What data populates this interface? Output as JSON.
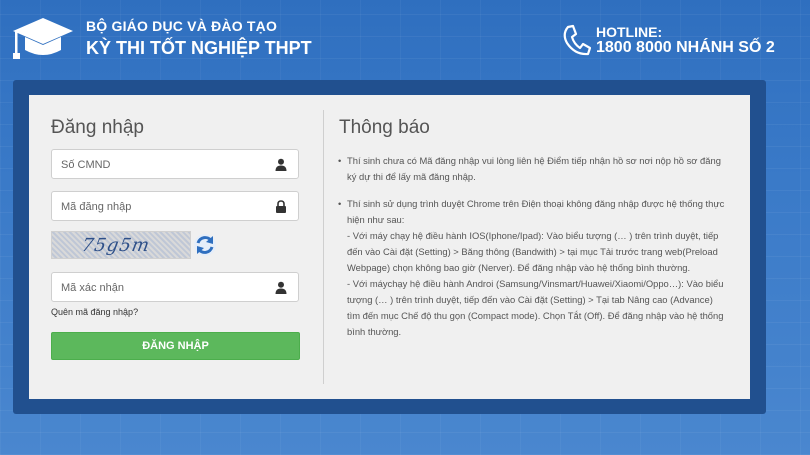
{
  "header": {
    "org": "BỘ GIÁO DỤC VÀ ĐÀO TẠO",
    "exam": "KỲ THI TỐT NGHIỆP THPT",
    "hotline_label": "HOTLINE:",
    "hotline_number": "1800 8000 NHÁNH SỐ 2"
  },
  "login": {
    "title": "Đăng nhập",
    "id_placeholder": "Số CMND",
    "code_placeholder": "Mã đăng nhập",
    "captcha_text": "75g5m",
    "captcha_placeholder": "Mã xác nhận",
    "forgot": "Quên mã đăng nhập?",
    "submit": "ĐĂNG NHẬP"
  },
  "notice": {
    "title": "Thông báo",
    "item1": "Thí sinh chưa có Mã đăng nhập vui lòng liên hệ Điểm tiếp nhận hồ sơ nơi nộp hồ sơ đăng ký dự thi để lấy mã đăng nhập.",
    "item2_intro": "Thí sinh sử dụng trình duyệt Chrome trên Điện thoại không đăng nhập được hệ thống thực hiện như sau:",
    "item2_ios": "- Với máy chạy hệ điều hành IOS(Iphone/Ipad): Vào biểu tượng (… ) trên trình duyệt, tiếp đến vào Cài đặt (Setting) > Băng thông (Bandwith) > tại mục Tải trước trang web(Preload Webpage) chọn không bao giờ (Nerver). Để đăng nhập vào hệ thống bình thường.",
    "item2_android": "- Với máychạy hệ điều hành Androi (Samsung/Vinsmart/Huawei/Xiaomi/Oppo…): Vào biểu tượng (… ) trên trình duyệt, tiếp đến vào Cài đặt (Setting) > Tại tab Nâng cao (Advance) tìm đến mục Chế độ thu gọn (Compact mode). Chọn Tắt (Off). Để đăng nhập vào hệ thống bình thường."
  },
  "colors": {
    "background": "#3a7ac8",
    "frame": "#21508f",
    "button": "#5cb85c"
  },
  "icons": {
    "logo": "graduation-cap-icon",
    "phone": "phone-icon",
    "user": "user-icon",
    "lock": "lock-icon",
    "refresh": "refresh-icon"
  }
}
